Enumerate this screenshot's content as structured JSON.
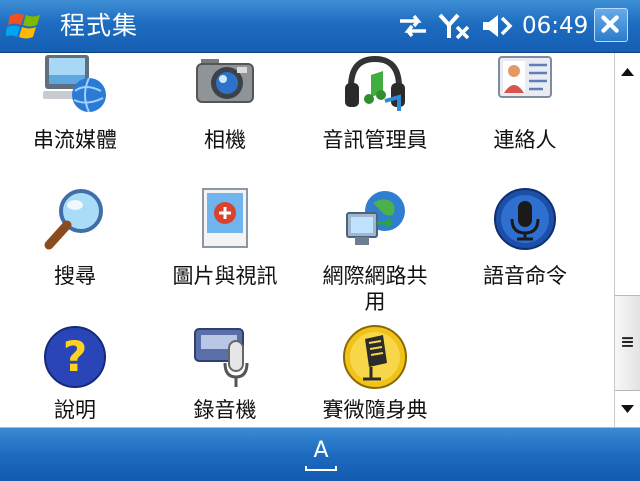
{
  "window": {
    "title": "程式集"
  },
  "status": {
    "time": "06:49"
  },
  "apps": [
    {
      "label": "串流媒體",
      "icon": "streaming-media-icon"
    },
    {
      "label": "相機",
      "icon": "camera-icon"
    },
    {
      "label": "音訊管理員",
      "icon": "audio-manager-icon"
    },
    {
      "label": "連絡人",
      "icon": "contacts-icon"
    },
    {
      "label": "搜尋",
      "icon": "search-icon"
    },
    {
      "label": "圖片與視訊",
      "icon": "pictures-videos-icon"
    },
    {
      "label": "網際網路共用",
      "label_wrap": "網際網路共\n用",
      "icon": "internet-sharing-icon"
    },
    {
      "label": "語音命令",
      "icon": "voice-command-icon"
    },
    {
      "label": "說明",
      "icon": "help-icon"
    },
    {
      "label": "錄音機",
      "icon": "voice-recorder-icon"
    },
    {
      "label": "賽微隨身典",
      "icon": "dictionary-icon"
    }
  ],
  "bottombar": {
    "input_label": "A"
  },
  "colors": {
    "titlebar": "#1e6cc0",
    "bottombar": "#1d6bc0",
    "text": "#111111"
  }
}
